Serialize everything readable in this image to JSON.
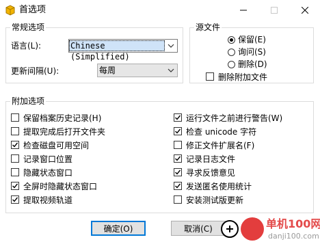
{
  "window": {
    "title": "首选项"
  },
  "general": {
    "title": "常规选项",
    "language_label": "语言(L):",
    "language_value": "Chinese (Simplified)",
    "update_label": "更新间隔(U):",
    "update_value": "每周"
  },
  "source": {
    "title": "源文件",
    "options": [
      {
        "label": "保留(E)",
        "selected": true
      },
      {
        "label": "询问(S)",
        "selected": false
      },
      {
        "label": "删除(D)",
        "selected": false
      }
    ],
    "delete_extra_label": "删除附加文件",
    "delete_extra_checked": false
  },
  "extra": {
    "title": "附加选项",
    "left": [
      {
        "label": "保留档案历史记录(H)",
        "checked": false
      },
      {
        "label": "提取完成后打开文件夹",
        "checked": false
      },
      {
        "label": "检查磁盘可用空间",
        "checked": true
      },
      {
        "label": "记录窗口位置",
        "checked": false
      },
      {
        "label": "隐藏状态窗口",
        "checked": false
      },
      {
        "label": "全屏时隐藏状态窗口",
        "checked": true
      },
      {
        "label": "提取视频轨道",
        "checked": true
      }
    ],
    "right": [
      {
        "label": "运行文件之前进行警告(W)",
        "checked": true
      },
      {
        "label": "检查 unicode 字符",
        "checked": true
      },
      {
        "label": "修正文件扩展名(F)",
        "checked": false
      },
      {
        "label": "记录日志文件",
        "checked": true
      },
      {
        "label": "寻求反馈意见",
        "checked": true
      },
      {
        "label": "发送匿名使用统计",
        "checked": true
      },
      {
        "label": "安装测试版更新",
        "checked": false
      }
    ]
  },
  "buttons": {
    "ok": "确定(O)",
    "cancel": "取消(C)"
  },
  "watermark": {
    "line1": "单机100网",
    "line2": "danji100.com"
  },
  "colors": {
    "accent": "#0078d7",
    "check": "#000000",
    "watermark": "#e33d3d"
  }
}
